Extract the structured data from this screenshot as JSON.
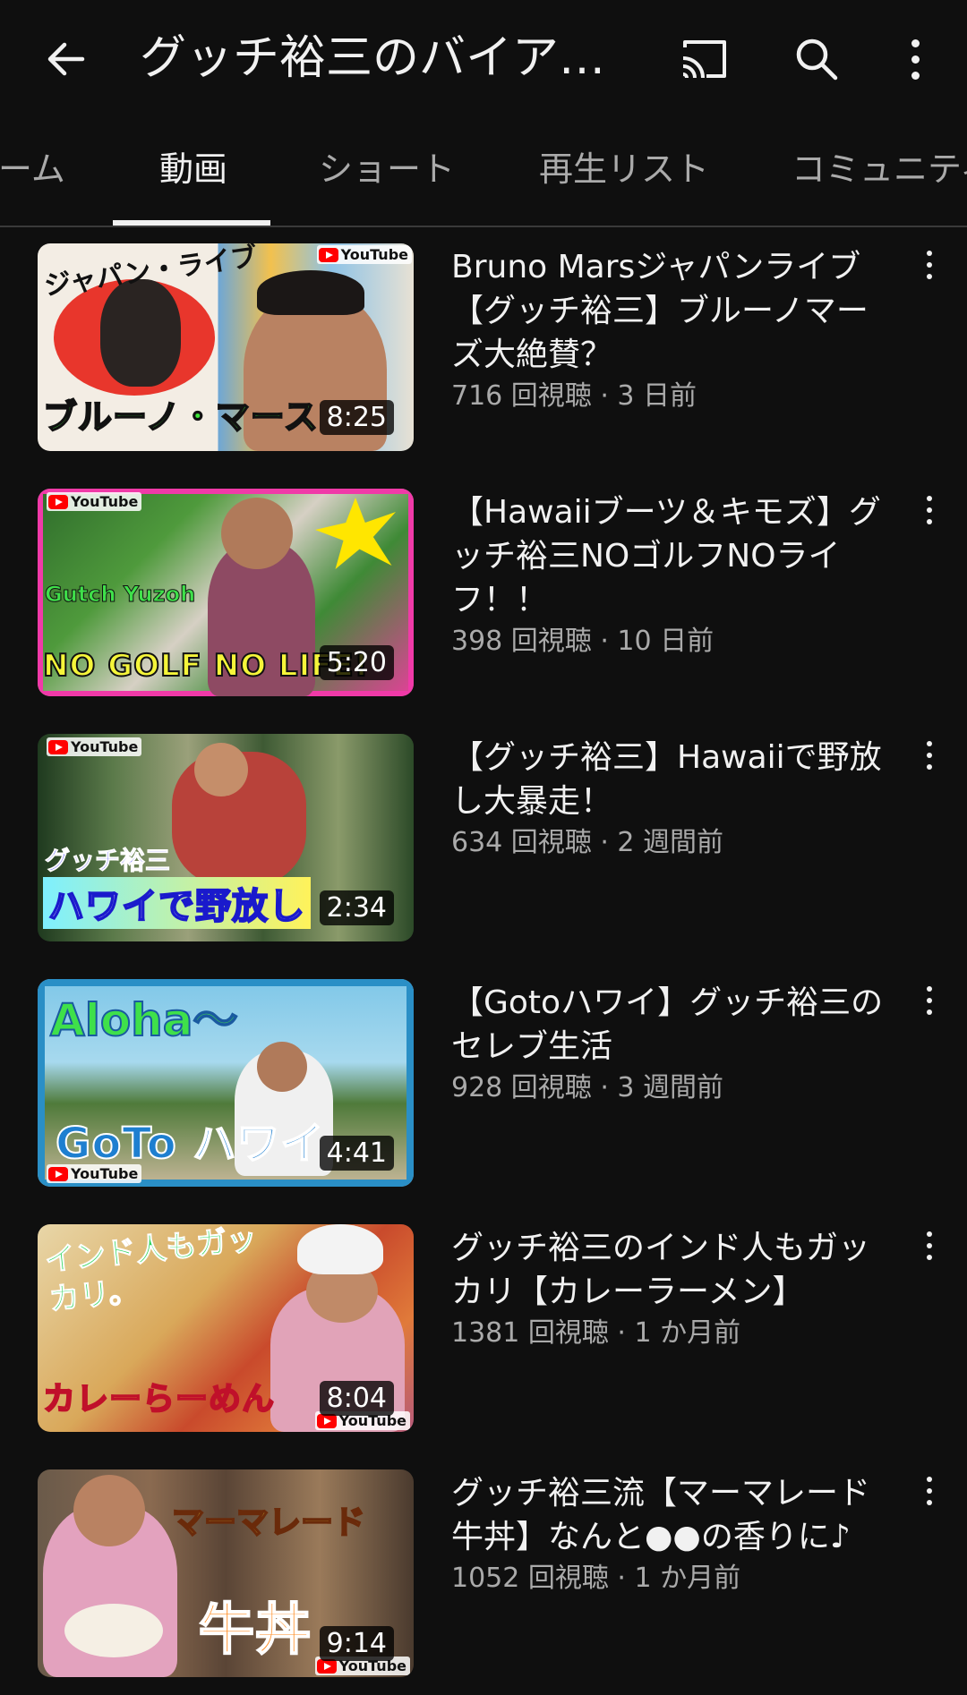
{
  "header": {
    "title": "グッチ裕三のバイアス...",
    "icons": {
      "back": "arrow-left-icon",
      "cast": "cast-icon",
      "search": "search-icon",
      "more": "more-vert-icon"
    }
  },
  "tabs": [
    {
      "label": "ホーム"
    },
    {
      "label": "動画",
      "active": true
    },
    {
      "label": "ショート"
    },
    {
      "label": "再生リスト"
    },
    {
      "label": "コミュニティ"
    }
  ],
  "videos": [
    {
      "title": "Bruno Marsジャパンライブ【グッチ裕三】ブルーノマーズ大絶賛？",
      "meta": "716 回視聴 · 3 日前",
      "duration": "8:25"
    },
    {
      "title": "【Hawaiiブーツ＆キモズ】グッチ裕三NOゴルフNOライフ！！",
      "meta": "398 回視聴 · 10 日前",
      "duration": "5:20"
    },
    {
      "title": "【グッチ裕三】Hawaiiで野放し大暴走！",
      "meta": "634 回視聴 · 2 週間前",
      "duration": "2:34"
    },
    {
      "title": "【Gotoハワイ】グッチ裕三のセレブ生活",
      "meta": "928 回視聴 · 3 週間前",
      "duration": "4:41"
    },
    {
      "title": "グッチ裕三のインド人もガッカリ【カレーラーメン】",
      "meta": "1381 回視聴 · 1 か月前",
      "duration": "8:04"
    },
    {
      "title": "グッチ裕三流【マーマレード牛丼】なんと●●の香りに♪",
      "meta": "1052 回視聴 · 1 か月前",
      "duration": "9:14"
    }
  ],
  "thumbnail_text": [
    {
      "caption": "ブルーノ・マース",
      "top_text": "ジャパン・ライブ",
      "badge": "YouTube"
    },
    {
      "caption": "NO GOLF NO LIFE!",
      "top_text": "Gutch Yuzoh",
      "badge": "YouTube"
    },
    {
      "caption": "ハワイで野放し",
      "top_text": "グッチ裕三",
      "badge": "YouTube"
    },
    {
      "caption": "GoTo ハワイ",
      "top_text": "Aloha～",
      "badge": "YouTube"
    },
    {
      "caption": "カレーらーめん",
      "top_text": "インド人もガッカリ。",
      "badge": "YouTube"
    },
    {
      "caption": "牛丼",
      "top_text": "マーマレード",
      "badge": "YouTube"
    }
  ]
}
